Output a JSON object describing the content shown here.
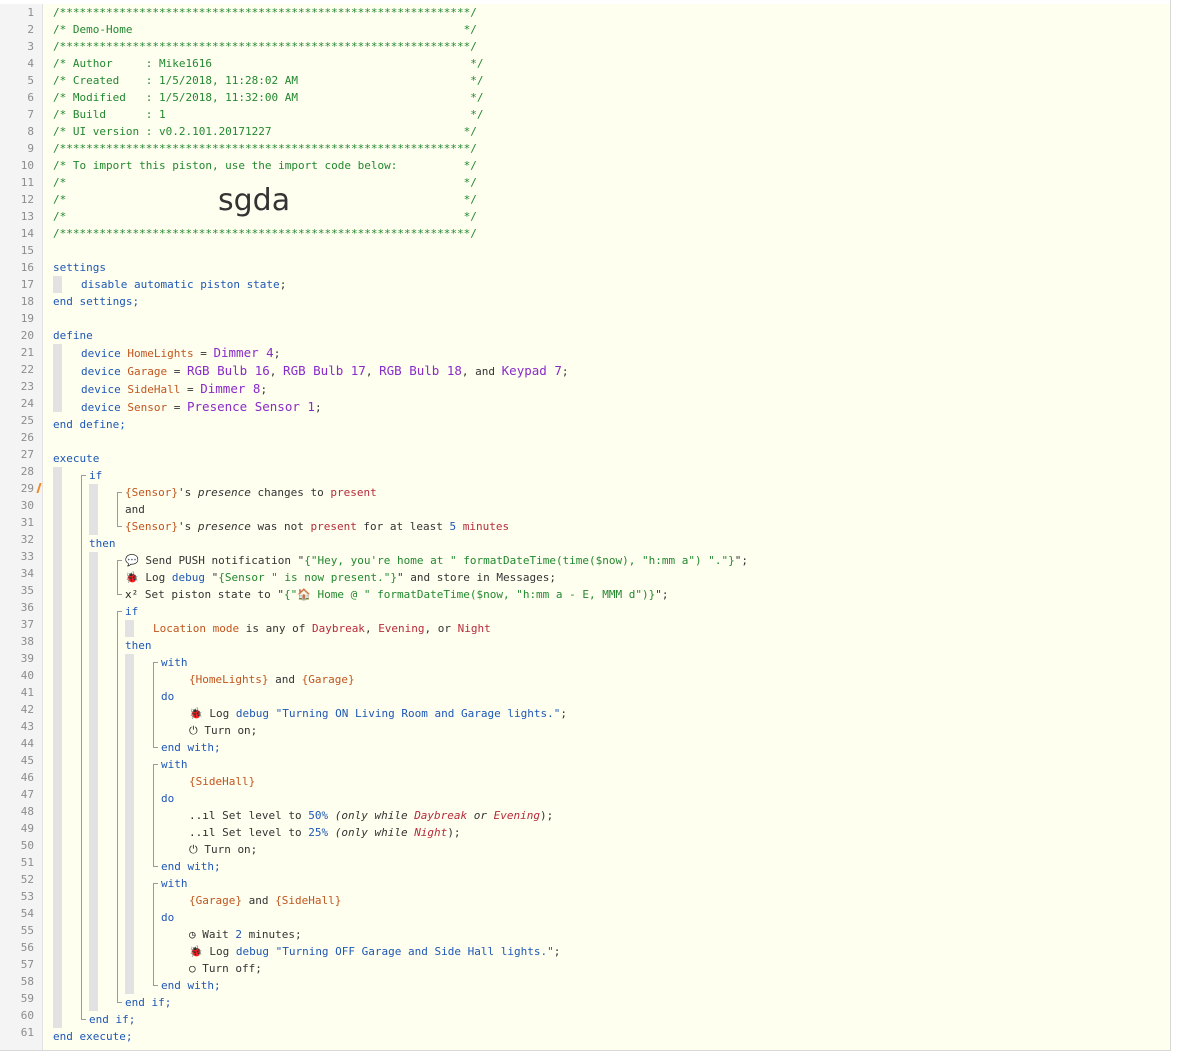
{
  "gutter": {
    "numbers": [
      "1",
      "2",
      "3",
      "4",
      "5",
      "6",
      "7",
      "8",
      "9",
      "10",
      "11",
      "12",
      "13",
      "14",
      "15",
      "16",
      "17",
      "18",
      "19",
      "20",
      "21",
      "22",
      "23",
      "24",
      "25",
      "26",
      "27",
      "28",
      "29",
      "30",
      "31",
      "32",
      "33",
      "34",
      "35",
      "36",
      "37",
      "38",
      "39",
      "40",
      "41",
      "42",
      "43",
      "44",
      "45",
      "46",
      "47",
      "48",
      "49",
      "50",
      "51",
      "52",
      "53",
      "54",
      "55",
      "56",
      "57",
      "58",
      "59",
      "60",
      "61"
    ]
  },
  "header": {
    "stars": "/**************************************************************/",
    "title": "/* Demo-Home                                                  */",
    "author": "/* Author     : Mike1616                                       */",
    "created": "/* Created    : 1/5/2018, 11:28:02 AM                          */",
    "modified": "/* Modified   : 1/5/2018, 11:32:00 AM                          */",
    "build": "/* Build      : 1                                              */",
    "ui_version": "/* UI version : v0.2.101.20171227                             */",
    "import_note": "/* To import this piston, use the import code below:          */",
    "blank": "/*                                                            */",
    "import_code": "sgda"
  },
  "settings": {
    "open": "settings",
    "body_kw": "disable automatic piston state",
    "semicolon": ";",
    "close": "end settings;"
  },
  "define": {
    "open": "define",
    "close": "end define;",
    "device_kw": "device",
    "eq": " = ",
    "home_var": "HomeLights",
    "home_dev": "Dimmer 4",
    "garage_var": "Garage",
    "garage_dev1": "RGB Bulb 16",
    "garage_dev2": "RGB Bulb 17",
    "garage_dev3": "RGB Bulb 18",
    "garage_dev4": "Keypad 7",
    "sidehall_var": "SideHall",
    "sidehall_dev": "Dimmer 8",
    "sensor_var": "Sensor",
    "sensor_dev": "Presence Sensor 1",
    "comma": ", ",
    "and_comma": ", and "
  },
  "execute": {
    "open": "execute",
    "close": "end execute;",
    "if_kw": "if",
    "then_kw": "then",
    "end_if": "end if;",
    "cond1_dev": "{Sensor}",
    "cond1_poss": "'s ",
    "cond1_attr": "presence",
    "cond1_op": " changes to ",
    "cond1_val": "present",
    "and_kw": "and",
    "cond2_dev": "{Sensor}",
    "cond2_poss": "'s ",
    "cond2_attr": "presence",
    "cond2_op": " was not ",
    "cond2_val": "present",
    "cond2_for": " for at least ",
    "cond2_num": "5",
    "cond2_unit": "minutes",
    "push_icon": "💬",
    "push_text": " Send PUSH notification \"",
    "push_expr": "{\"Hey, you're home at \" formatDateTime(time($now), \"h:mm a\") \".\"}",
    "push_end": "\";",
    "log_icon": "🐞",
    "log_label": " Log ",
    "log_debug": "debug",
    "log1_open": " \"",
    "log1_expr": "{Sensor \" is now present.\"}",
    "log1_close": "\" and store in Messages;",
    "state_icon": "x²",
    "state_text": " Set piston state to \"",
    "state_expr": "{\"🏠 Home @ \" formatDateTime($now, \"h:mm a - E, MMM d\")}",
    "state_end": "\";",
    "inner_if": "if",
    "loc_var": "Location mode",
    "loc_op": " is any of ",
    "loc_v1": "Daybreak",
    "loc_v2": "Evening",
    "loc_v3": "Night",
    "loc_c": ", ",
    "loc_or": ", or ",
    "inner_then": "then",
    "inner_end_if": "end if;",
    "with_kw": "with",
    "do_kw": "do",
    "end_with": "end with;",
    "w1_dev1": "{HomeLights}",
    "w1_and": " and ",
    "w1_dev2": "{Garage}",
    "w1_log": "\"Turning ON Living Room and Garage lights.\"",
    "semi": ";",
    "power_icon": "⏻",
    "turn_on": " Turn on;",
    "w2_dev": "{SideHall}",
    "level_icon": "..ıl",
    "set_level": " Set level to ",
    "lvl1": "50%",
    "only_while_open": " (only while ",
    "only_daybreak": "Daybreak",
    "only_or": " or ",
    "only_evening": "Evening",
    "only_close": ");",
    "lvl2": "25%",
    "only_night": "Night",
    "w3_dev1": "{Garage}",
    "w3_and": " and ",
    "w3_dev2": "{SideHall}",
    "wait_icon": "◷",
    "wait_text": " Wait ",
    "wait_num": "2",
    "wait_unit": " minutes;",
    "w3_log": "\"Turning OFF Garage and Side Hall lights.\"",
    "off_icon": "○",
    "turn_off": " Turn off;"
  }
}
